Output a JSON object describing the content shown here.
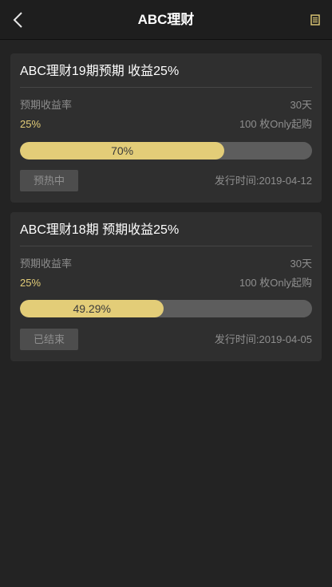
{
  "header": {
    "title": "ABC理财",
    "back_icon": "chevron-left-icon",
    "doc_icon": "document-icon",
    "accent": "#e3cd78"
  },
  "products": [
    {
      "title": "ABC理财19期预期 收益25%",
      "rate_label": "预期收益率",
      "rate_value": "25%",
      "term": "30天",
      "min_purchase": "100 枚Only起购",
      "progress": 70,
      "progress_label": "70%",
      "status": "预热中",
      "issue_date": "发行时间:2019-04-12"
    },
    {
      "title": "ABC理财18期 预期收益25%",
      "rate_label": "预期收益率",
      "rate_value": "25%",
      "term": "30天",
      "min_purchase": "100 枚Only起购",
      "progress": 49.29,
      "progress_label": "49.29%",
      "status": "已结束",
      "issue_date": "发行时间:2019-04-05"
    }
  ]
}
